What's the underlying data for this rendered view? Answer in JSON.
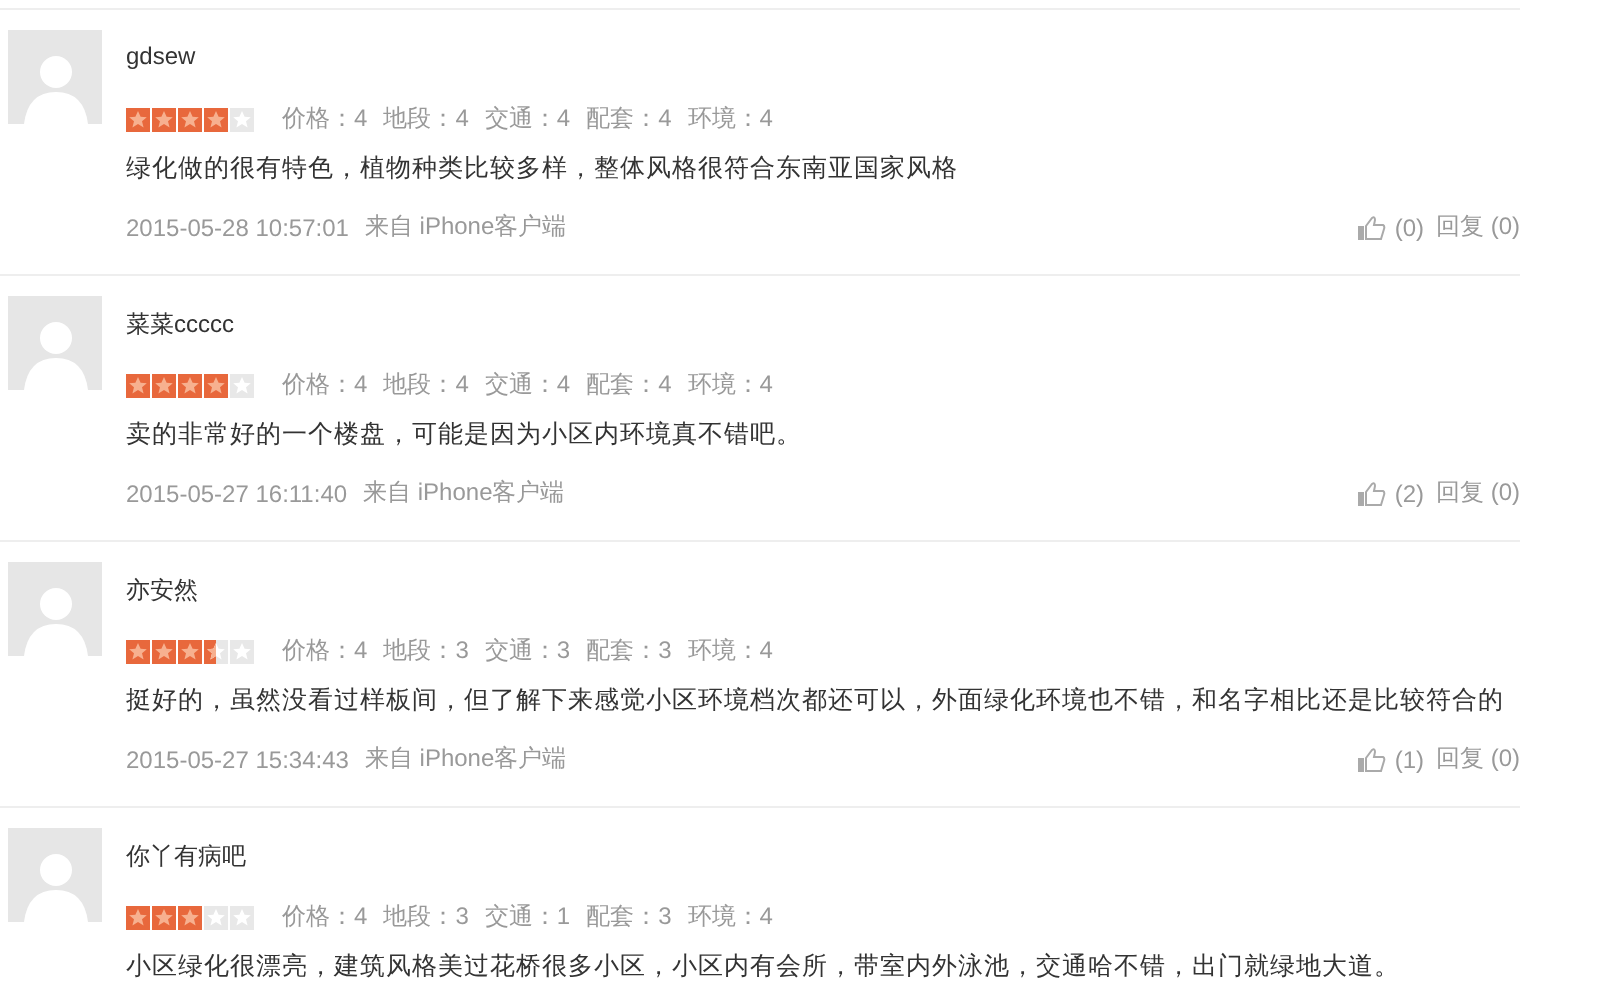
{
  "comments": [
    {
      "user": "gdsew",
      "stars": 4,
      "scores": [
        "价格：4",
        "地段：4",
        "交通：4",
        "配套：4",
        "环境：4"
      ],
      "text": "绿化做的很有特色，植物种类比较多样，整体风格很符合东南亚国家风格",
      "time": "2015-05-28 10:57:01",
      "source": "来自 iPhone客户端",
      "likes": "(0)",
      "reply": "回复 (0)"
    },
    {
      "user": "菜菜ccccc",
      "stars": 4,
      "scores": [
        "价格：4",
        "地段：4",
        "交通：4",
        "配套：4",
        "环境：4"
      ],
      "text": "卖的非常好的一个楼盘，可能是因为小区内环境真不错吧。",
      "time": "2015-05-27 16:11:40",
      "source": "来自 iPhone客户端",
      "likes": "(2)",
      "reply": "回复 (0)"
    },
    {
      "user": "亦安然",
      "stars": 3.5,
      "scores": [
        "价格：4",
        "地段：3",
        "交通：3",
        "配套：3",
        "环境：4"
      ],
      "text": "挺好的，虽然没看过样板间，但了解下来感觉小区环境档次都还可以，外面绿化环境也不错，和名字相比还是比较符合的",
      "time": "2015-05-27 15:34:43",
      "source": "来自 iPhone客户端",
      "likes": "(1)",
      "reply": "回复 (0)"
    },
    {
      "user": "你丫有病吧",
      "stars": 3,
      "scores": [
        "价格：4",
        "地段：3",
        "交通：1",
        "配套：3",
        "环境：4"
      ],
      "text": "小区绿化很漂亮，建筑风格美过花桥很多小区，小区内有会所，带室内外泳池，交通哈不错，出门就绿地大道。"
    }
  ]
}
